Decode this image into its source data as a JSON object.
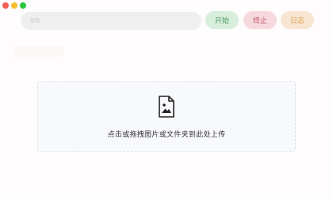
{
  "window": {
    "controls": [
      {
        "name": "close",
        "color": "#f25f58"
      },
      {
        "name": "minimize",
        "color": "#f9be2e"
      },
      {
        "name": "zoom",
        "color": "#2ac840"
      }
    ]
  },
  "toolbar": {
    "search_placeholder": "IPR",
    "start_label": "开始",
    "stop_label": "终止",
    "log_label": "日志"
  },
  "dropzone": {
    "icon": "image-file-icon",
    "prompt": "点击或拖拽图片或文件夹到此处上传"
  }
}
